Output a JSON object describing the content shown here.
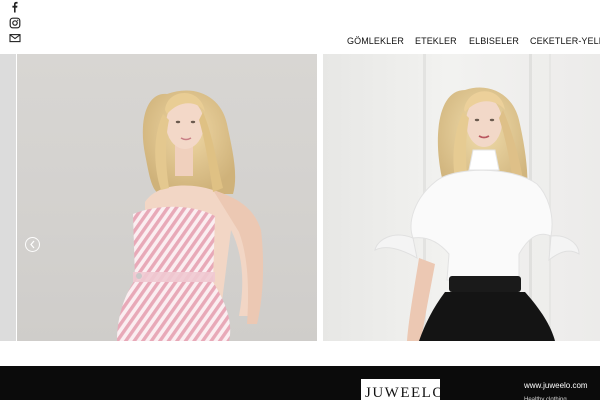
{
  "header": {
    "social_icons": [
      "facebook-icon",
      "instagram-icon",
      "mail-icon"
    ],
    "nav": [
      {
        "label": "GÖMLEKLER"
      },
      {
        "label": "ETEKLER"
      },
      {
        "label": "ELBISELER"
      },
      {
        "label": "CEKETLER-YELEKLER"
      }
    ]
  },
  "slider": {
    "prev_icon": "chevron-left-icon",
    "slides": [
      {
        "name": "model-pink-striped-dress"
      },
      {
        "name": "model-white-ruffle-blouse"
      }
    ]
  },
  "footer": {
    "logo_text": "JUWEELO",
    "url": "www.juweelo.com",
    "subtext": "Healthy clothing"
  },
  "colors": {
    "footer_bg": "#0b0b0b",
    "text": "#111111",
    "pink_stripe": "#e8a9b8"
  }
}
